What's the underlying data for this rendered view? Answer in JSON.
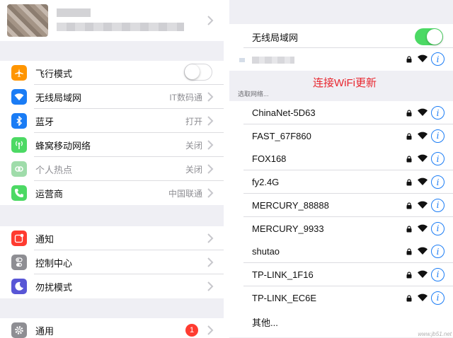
{
  "left": {
    "groups": [
      [
        {
          "label": "飞行模式",
          "value": "",
          "icon": "airplane-icon",
          "color": "#ff9500",
          "toggle": "off"
        },
        {
          "label": "无线局域网",
          "value": "IT数码通",
          "icon": "wifi-icon",
          "color": "#1a7cf5"
        },
        {
          "label": "蓝牙",
          "value": "打开",
          "icon": "bluetooth-icon",
          "color": "#1a7cf5"
        },
        {
          "label": "蜂窝移动网络",
          "value": "关闭",
          "icon": "cellular-icon",
          "color": "#4cd964"
        },
        {
          "label": "个人热点",
          "value": "关闭",
          "icon": "hotspot-icon",
          "color": "#9fdcaa",
          "dim": true
        },
        {
          "label": "运营商",
          "value": "中国联通",
          "icon": "phone-icon",
          "color": "#4cd964"
        }
      ],
      [
        {
          "label": "通知",
          "value": "",
          "icon": "notifications-icon",
          "color": "#ff3b30"
        },
        {
          "label": "控制中心",
          "value": "",
          "icon": "control-center-icon",
          "color": "#8e8e93"
        },
        {
          "label": "勿扰模式",
          "value": "",
          "icon": "moon-icon",
          "color": "#5856d6"
        }
      ],
      [
        {
          "label": "通用",
          "value": "",
          "icon": "gear-icon",
          "color": "#8e8e93",
          "badge": "1"
        }
      ]
    ]
  },
  "right": {
    "wlan_label": "无线局域网",
    "annotation": "连接WiFi更新",
    "choose_label": "选取网络...",
    "networks": [
      "ChinaNet-5D63",
      "FAST_67F860",
      "FOX168",
      "fy2.4G",
      "MERCURY_88888",
      "MERCURY_9933",
      "shutao",
      "TP-LINK_1F16",
      "TP-LINK_EC6E"
    ],
    "other_label": "其他...",
    "info_glyph": "i"
  },
  "watermark": "www.jb51.net",
  "colors": {
    "accent": "#1a7cf5",
    "toggle_on": "#4cd964",
    "annotation": "#e8262e",
    "badge": "#ff3b30"
  }
}
